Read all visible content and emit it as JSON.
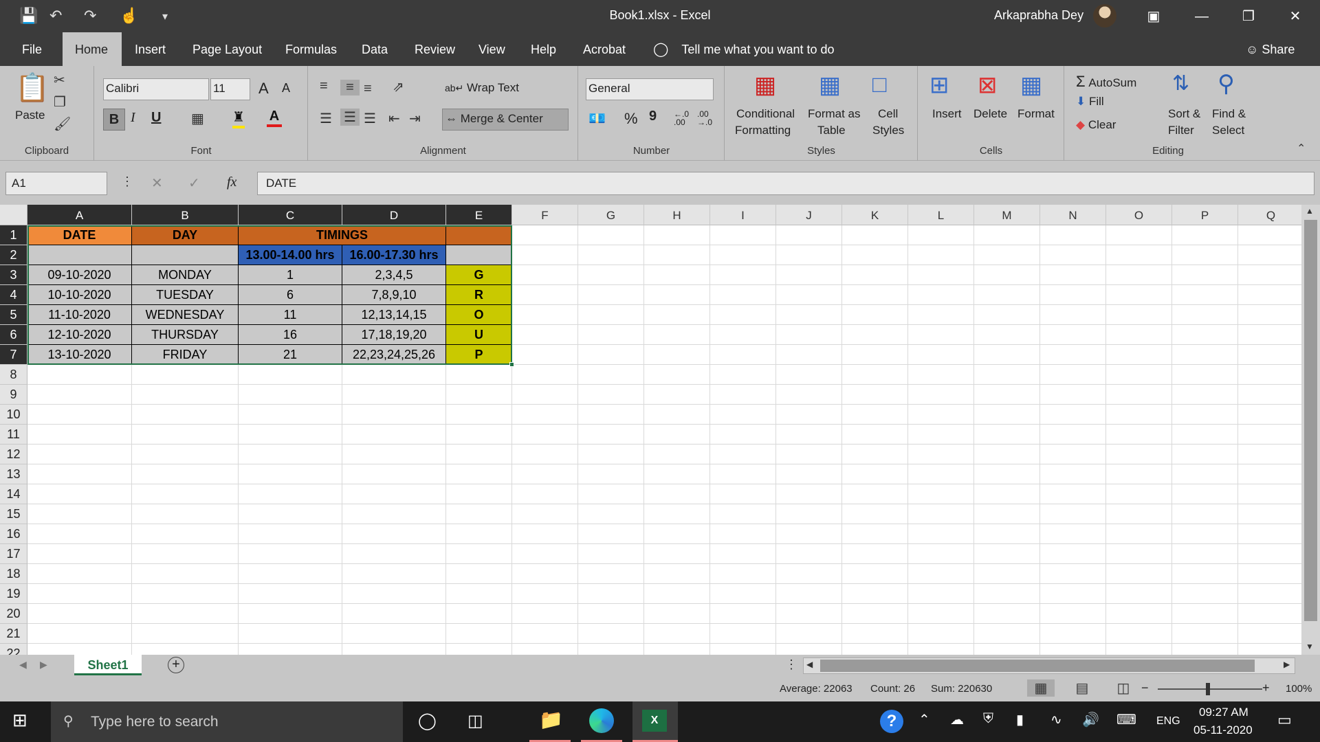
{
  "window": {
    "title": "Book1.xlsx  -  Excel",
    "user": "Arkaprabha Dey"
  },
  "menu": {
    "tabs": [
      "File",
      "Home",
      "Insert",
      "Page Layout",
      "Formulas",
      "Data",
      "Review",
      "View",
      "Help",
      "Acrobat"
    ],
    "active": "Home",
    "tell_me": "Tell me what you want to do",
    "share": "Share"
  },
  "ribbon": {
    "clipboard": {
      "label": "Clipboard",
      "paste": "Paste"
    },
    "font": {
      "label": "Font",
      "name": "Calibri",
      "size": "11",
      "bold": "B",
      "italic": "I",
      "underline": "U",
      "grow": "A",
      "shrink": "A"
    },
    "alignment": {
      "label": "Alignment",
      "wrap": "Wrap Text",
      "merge": "Merge & Center"
    },
    "number": {
      "label": "Number",
      "format": "General",
      "percent": "%",
      "comma": "9",
      "inc": "←.0\n.00",
      "dec": ".00\n→.0"
    },
    "styles": {
      "label": "Styles",
      "conditional_1": "Conditional",
      "conditional_2": "Formatting",
      "table_1": "Format as",
      "table_2": "Table",
      "cell_1": "Cell",
      "cell_2": "Styles"
    },
    "cells": {
      "label": "Cells",
      "insert": "Insert",
      "delete": "Delete",
      "format": "Format"
    },
    "editing": {
      "label": "Editing",
      "autosum": "AutoSum",
      "fill": "Fill",
      "clear": "Clear",
      "sort_1": "Sort &",
      "sort_2": "Filter",
      "find_1": "Find &",
      "find_2": "Select"
    }
  },
  "formula_bar": {
    "name_box": "A1",
    "fx": "fx",
    "value": "DATE"
  },
  "columns": [
    "A",
    "B",
    "C",
    "D",
    "E",
    "F",
    "G",
    "H",
    "I",
    "J",
    "K",
    "L",
    "M",
    "N",
    "O",
    "P",
    "Q"
  ],
  "rows": [
    "1",
    "2",
    "3",
    "4",
    "5",
    "6",
    "7",
    "8",
    "9",
    "10",
    "11",
    "12",
    "13",
    "14",
    "15",
    "16",
    "17",
    "18",
    "19",
    "20",
    "21",
    "22"
  ],
  "table": {
    "header": [
      "DATE",
      "DAY",
      "TIMINGS",
      ""
    ],
    "subheader": [
      "",
      "",
      "13.00-14.00 hrs",
      "16.00-17.30 hrs",
      ""
    ],
    "body": [
      [
        "09-10-2020",
        "MONDAY",
        "1",
        "2,3,4,5",
        "G"
      ],
      [
        "10-10-2020",
        "TUESDAY",
        "6",
        "7,8,9,10",
        "R"
      ],
      [
        "11-10-2020",
        "WEDNESDAY",
        "11",
        "12,13,14,15",
        "O"
      ],
      [
        "12-10-2020",
        "THURSDAY",
        "16",
        "17,18,19,20",
        "U"
      ],
      [
        "13-10-2020",
        "FRIDAY",
        "21",
        "22,23,24,25,26",
        "P"
      ]
    ],
    "colors": {
      "orange": "#f08a3a",
      "dark_orange": "#c7641f",
      "blue": "#2f5fb5",
      "gray": "#c9c9c9",
      "lime": "#c9c900"
    }
  },
  "sheet": {
    "tab": "Sheet1",
    "add": "+"
  },
  "status": {
    "average": "Average: 22063",
    "count": "Count: 26",
    "sum": "Sum: 220630",
    "zoom": "100%",
    "minus": "−",
    "plus": "+"
  },
  "taskbar": {
    "search": "Type here to search",
    "lang": "ENG",
    "time": "09:27 AM",
    "date": "05-11-2020",
    "help": "?"
  }
}
